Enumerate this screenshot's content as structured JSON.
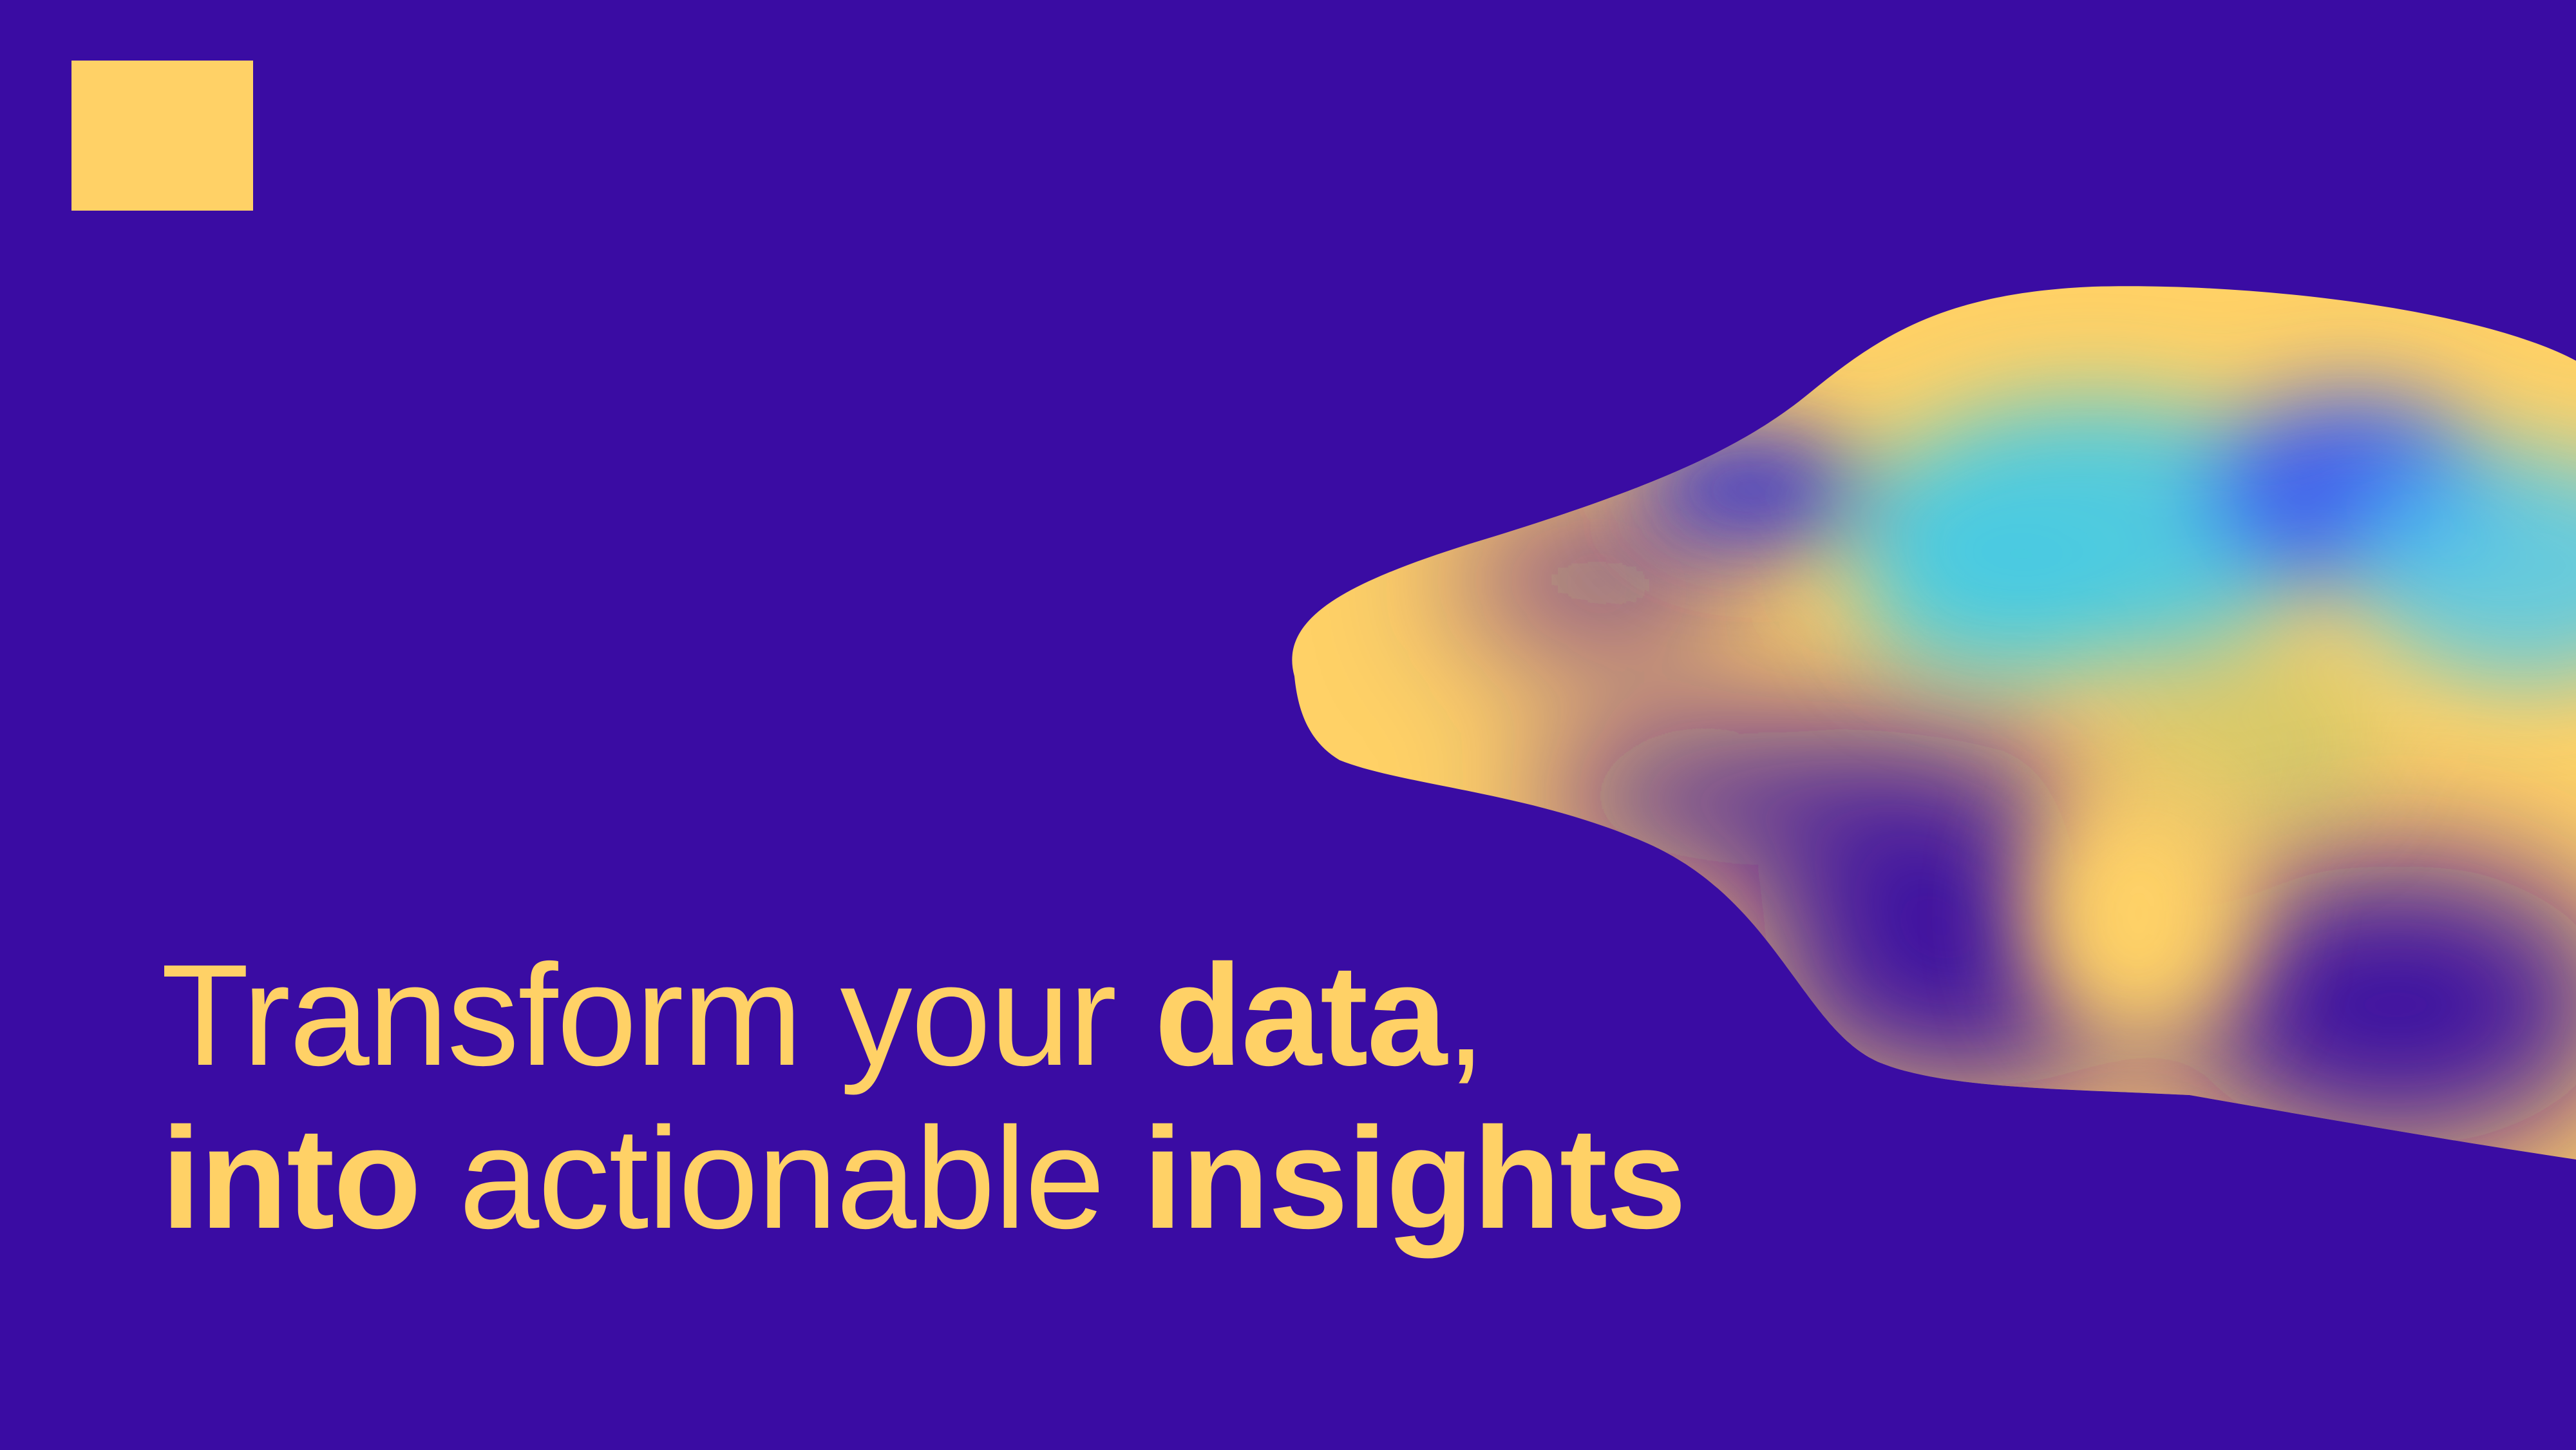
{
  "colors": {
    "background": "#3a0ca3",
    "accent_yellow": "#ffd166",
    "accent_cyan": "#48cae4",
    "accent_blue": "#4361ee"
  },
  "decorations": {
    "logo_shape": "yellow-square",
    "blob_shape": "gradient-wave-blob"
  },
  "headline": {
    "line1": {
      "part1": "Transform your ",
      "part2_bold": "data",
      "part3": ","
    },
    "line2": {
      "part1_bold": "into",
      "part2": " actionable ",
      "part3_bold": "insights"
    }
  }
}
